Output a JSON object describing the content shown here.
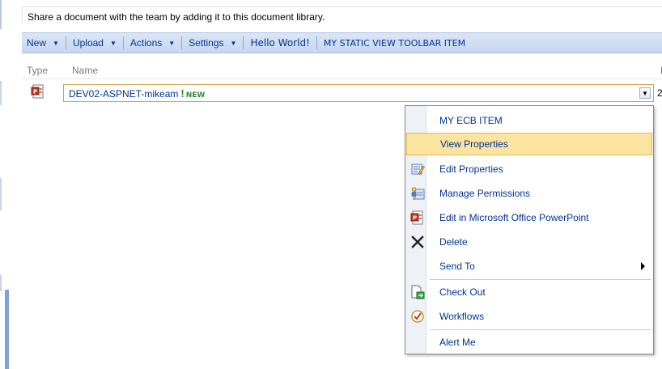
{
  "library": {
    "description": "Share a document with the team by adding it to this document library."
  },
  "toolbar": {
    "new_label": "New",
    "upload_label": "Upload",
    "actions_label": "Actions",
    "settings_label": "Settings",
    "hello_label": "Hello World!",
    "static_label": "MY STATIC VIEW TOOLBAR ITEM"
  },
  "columns": {
    "type": "Type",
    "name": "Name",
    "next_clipped": "M"
  },
  "item": {
    "name": "DEV02-ASPNET-mikeam",
    "new_badge_mark": "!",
    "new_badge_text": "NEW",
    "right_clipped": "2",
    "icon": "powerpoint-doc-icon"
  },
  "context_menu": {
    "items": [
      {
        "label": "MY ECB ITEM",
        "icon": ""
      },
      {
        "label": "View Properties",
        "icon": "",
        "highlighted": true
      },
      {
        "label": "Edit Properties",
        "icon": "edit-properties-icon"
      },
      {
        "label": "Manage Permissions",
        "icon": "manage-permissions-icon"
      },
      {
        "label": "Edit in Microsoft Office PowerPoint",
        "icon": "powerpoint-icon"
      },
      {
        "label": "Delete",
        "icon": "delete-x-icon"
      },
      {
        "label": "Send To",
        "icon": "",
        "submenu": true
      },
      {
        "label": "Check Out",
        "icon": "check-out-icon"
      },
      {
        "label": "Workflows",
        "icon": "workflows-icon"
      },
      {
        "label": "Alert Me",
        "icon": ""
      }
    ]
  },
  "colors": {
    "link": "#003399",
    "toolbar_bg": "#c5d6ef",
    "highlight": "#fbe3a0",
    "new_badge": "#2e8b3a"
  }
}
